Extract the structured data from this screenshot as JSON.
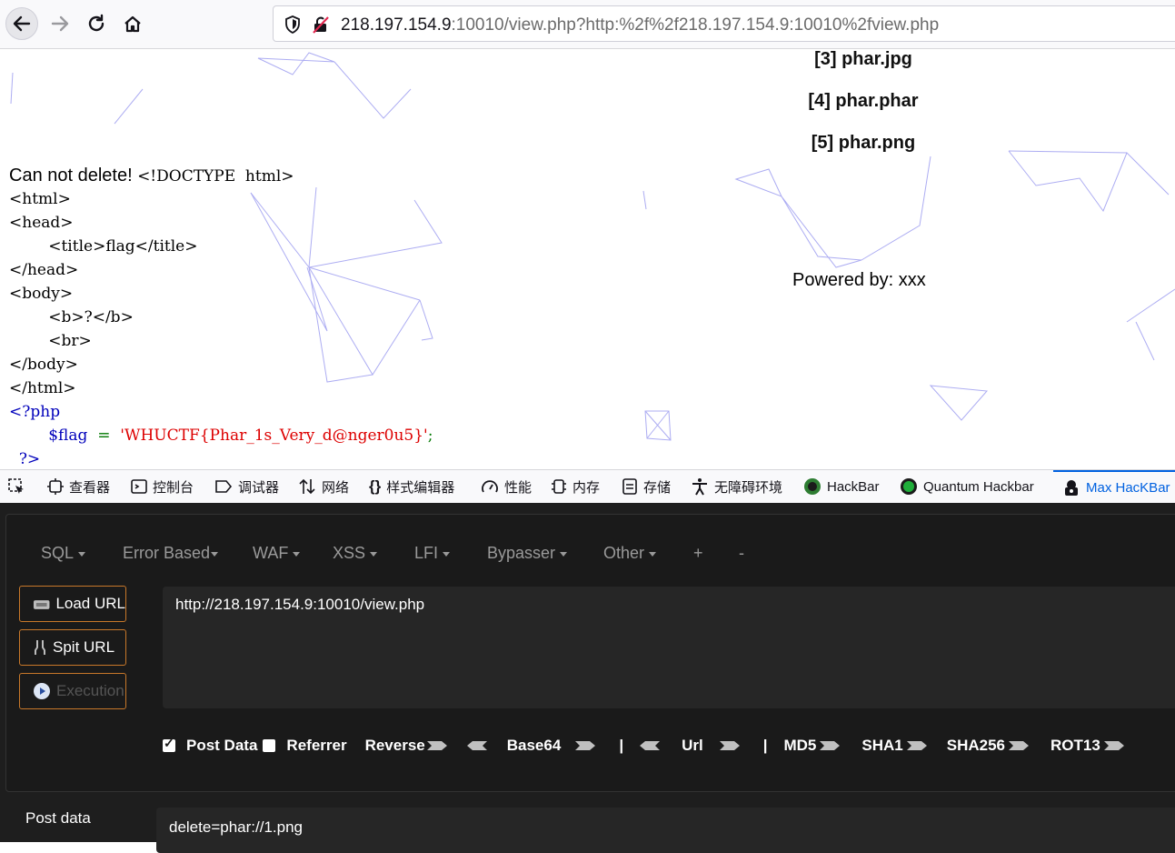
{
  "browser": {
    "url_host": "218.197.154.9",
    "url_rest": ":10010/view.php?http:%2f%2f218.197.154.9:10010%2fview.php"
  },
  "page": {
    "files": [
      "[3] phar.jpg",
      "[4] phar.phar",
      "[5] phar.png"
    ],
    "message": "Can not delete!",
    "source_lines": [
      "<!DOCTYPE  html>",
      "<html>",
      "<head>",
      "        <title>flag</title>",
      "</head>",
      "<body>",
      "        <b>?</b>",
      "        <br>",
      "</body>",
      "</html>"
    ],
    "php_open": "<?php",
    "flag_var": "$flag",
    "flag_eq": "=",
    "flag_value": "'WHUCTF{Phar_1s_Very_d@nger0u5}'",
    "flag_semicolon": ";",
    "php_close": "?>",
    "powered_by": "Powered by: xxx"
  },
  "devtools": {
    "tabs": [
      "查看器",
      "控制台",
      "调试器",
      "网络",
      "样式编辑器",
      "性能",
      "内存",
      "存储",
      "无障碍环境",
      "HackBar",
      "Quantum Hackbar",
      "Max HacKBar"
    ],
    "active_tab": "Max HacKBar"
  },
  "hackbar": {
    "menu": [
      "SQL",
      "Error Based",
      "WAF",
      "XSS",
      "LFI",
      "Bypasser",
      "Other",
      "+",
      "-"
    ],
    "load_url": "Load URL",
    "split_url": "Spit URL",
    "execution": "Execution",
    "url_value": "http://218.197.154.9:10010/view.php",
    "post_data_checkbox": "Post Data",
    "referrer_checkbox": "Referrer",
    "post_data_checked": true,
    "referrer_checked": false,
    "transforms": [
      "Reverse",
      "Base64",
      "|",
      "Url",
      "|",
      "MD5",
      "SHA1",
      "SHA256",
      "ROT13"
    ],
    "post_label": "Post data",
    "post_value": "delete=phar://1.png"
  },
  "colors": {
    "accent": "#0061e0",
    "button_border": "#c8782a",
    "panel_bg": "#1e1e1e",
    "php_keyword": "#0000bb",
    "php_string": "#dd0000"
  }
}
